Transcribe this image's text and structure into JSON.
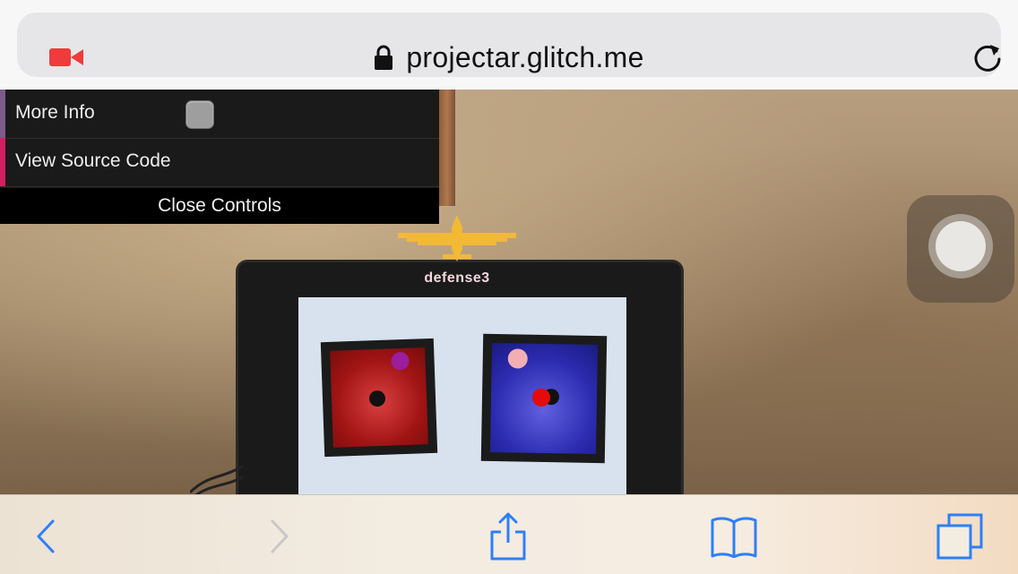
{
  "browser": {
    "url": "projectar.glitch.me",
    "icons": {
      "camera": "video-camera-icon",
      "lock": "lock-icon",
      "reload": "reload-icon"
    },
    "accent_color": "#ef3b3b"
  },
  "controls": {
    "more_info_label": "More Info",
    "view_source_label": "View Source Code",
    "close_label": "Close Controls",
    "more_info_checked": false,
    "accent_colors": {
      "more_info": "#7c5b8a",
      "view_source": "#d21f5f"
    }
  },
  "scene": {
    "plane_label": "defense3"
  },
  "toolbar": {
    "icons": [
      "back-icon",
      "forward-icon",
      "share-icon",
      "bookmarks-icon",
      "tabs-icon"
    ],
    "button_color": "#2d7ff9",
    "disabled_color": "#c8c8c8"
  }
}
